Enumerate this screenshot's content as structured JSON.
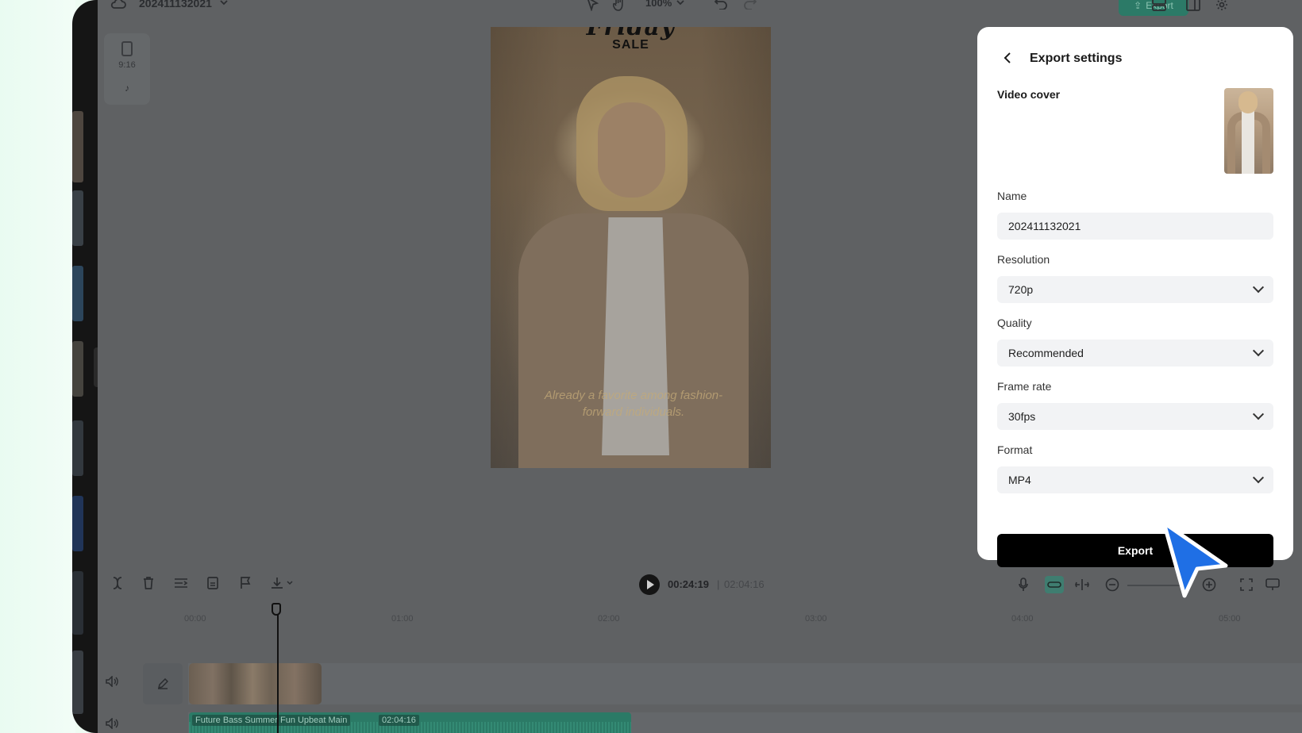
{
  "project": {
    "name": "202411132021"
  },
  "toolbar": {
    "zoom": "100%",
    "export_label": "Export"
  },
  "ratio": {
    "label": "9:16"
  },
  "video": {
    "title_script": "Friday",
    "title_sale": "SALE",
    "caption_line1": "Already a favorite among fashion-",
    "caption_line2": "forward individuals."
  },
  "playback": {
    "current": "00:24:19",
    "separator": "|",
    "total": "02:04:16"
  },
  "ruler": {
    "ticks": [
      "00:00",
      "01:00",
      "02:00",
      "03:00",
      "04:00",
      "05:00"
    ]
  },
  "audio": {
    "name": "Future Bass Summer Fun Upbeat Main",
    "duration": "02:04:16"
  },
  "export_panel": {
    "title": "Export settings",
    "video_cover_label": "Video cover",
    "name_label": "Name",
    "name_value": "202411132021",
    "resolution_label": "Resolution",
    "resolution_value": "720p",
    "quality_label": "Quality",
    "quality_value": "Recommended",
    "frame_rate_label": "Frame rate",
    "frame_rate_value": "30fps",
    "format_label": "Format",
    "format_value": "MP4",
    "export_button": "Export"
  },
  "colors": {
    "accent": "#2c7a67",
    "cursor": "#1f6fe5",
    "panel_bg": "#ffffff",
    "overlay": "#5f6163"
  }
}
